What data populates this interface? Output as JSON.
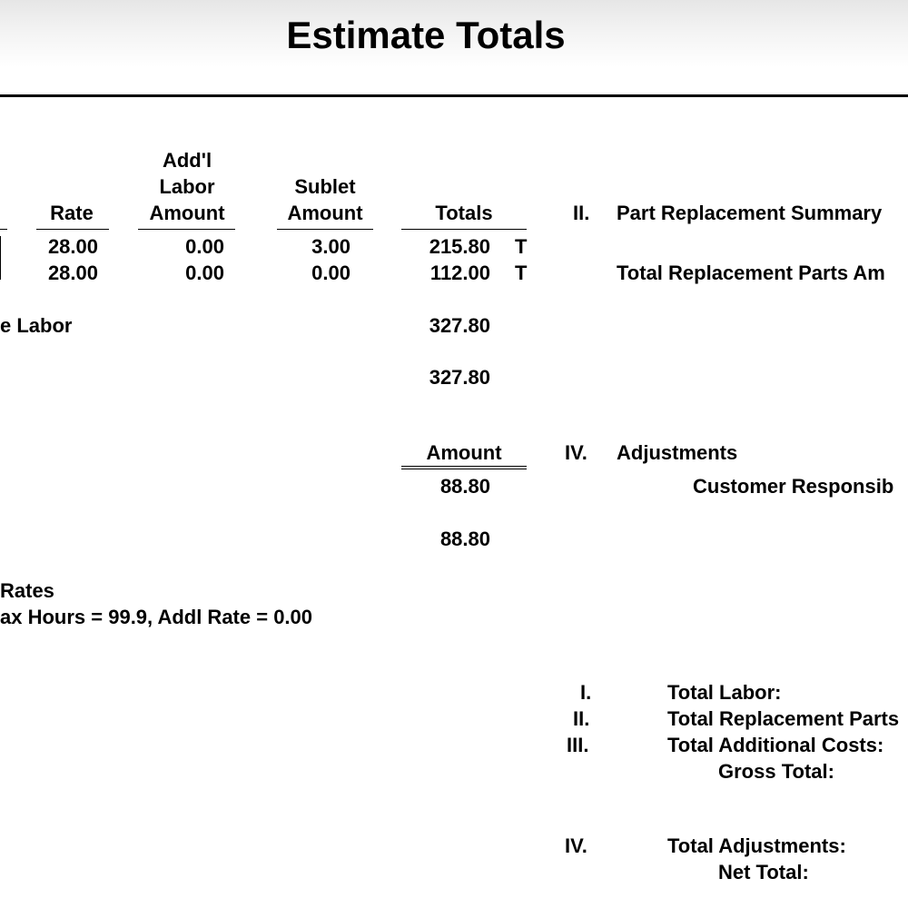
{
  "page": {
    "title": "Estimate Totals"
  },
  "labor": {
    "headers": {
      "rate": "Rate",
      "addl_line1": "Add'l",
      "addl_line2": "Labor",
      "addl_line3": "Amount",
      "sublet_line1": "Sublet",
      "sublet_line2": "Amount",
      "totals": "Totals"
    },
    "rows": [
      {
        "rate": "28.00",
        "addl": "0.00",
        "sublet": "3.00",
        "total": "215.80",
        "flag": "T"
      },
      {
        "rate": "28.00",
        "addl": "0.00",
        "sublet": "0.00",
        "total": "112.00",
        "flag": "T"
      }
    ],
    "subtotal_label_fragment": "e Labor",
    "subtotal": "327.80",
    "total": "327.80"
  },
  "additional": {
    "amount_header": "Amount",
    "value1": "88.80",
    "value2": "88.80"
  },
  "rates": {
    "heading_fragment": "Rates",
    "detail_fragment": "ax Hours = 99.9, Addl Rate = 0.00"
  },
  "parts": {
    "numeral": "II.",
    "heading": "Part Replacement Summary",
    "line_fragment": "Total Replacement Parts Am"
  },
  "adjustments": {
    "numeral": "IV.",
    "heading": "Adjustments",
    "line_fragment": "Customer Responsib"
  },
  "summary": {
    "items": [
      {
        "numeral": "I.",
        "label": "Total Labor:"
      },
      {
        "numeral": "II.",
        "label": "Total Replacement Parts"
      },
      {
        "numeral": "III.",
        "label": "Total Additional Costs:"
      }
    ],
    "gross_label": "Gross Total:",
    "adjust_numeral": "IV.",
    "adjust_label": "Total Adjustments:",
    "net_label": "Net Total:"
  }
}
